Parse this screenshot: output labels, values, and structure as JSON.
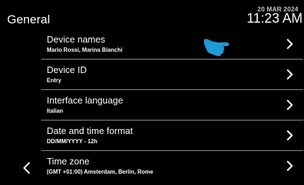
{
  "header": {
    "title": "General",
    "date": "20 MAR 2024",
    "time": "11:23 AM"
  },
  "settings": {
    "items": [
      {
        "label": "Device names",
        "value": "Mario Rossi, Marina Bianchi"
      },
      {
        "label": "Device ID",
        "value": "Entry"
      },
      {
        "label": "Interface language",
        "value": "Italian"
      },
      {
        "label": "Date and time format",
        "value": "DD/MM/YYYY - 12h"
      },
      {
        "label": "Time zone",
        "value": "(GMT +01:00) Amsterdam, Berlin, Rome"
      }
    ]
  },
  "icons": {
    "back": "chevron-left-icon",
    "row_arrow": "chevron-right-icon",
    "pointer": "pointing-hand-icon"
  },
  "colors": {
    "background": "#000000",
    "text": "#ffffff",
    "divider": "#8f8f8f",
    "pointer": "#1e9ad6"
  }
}
